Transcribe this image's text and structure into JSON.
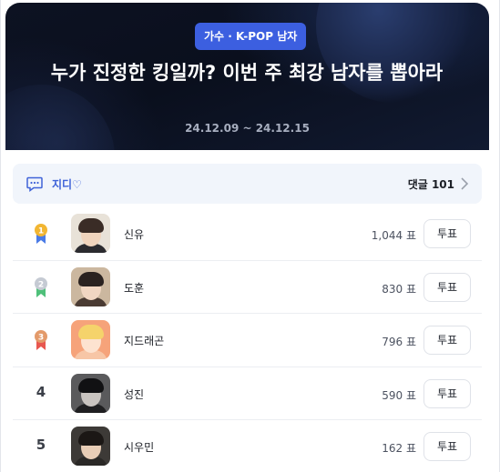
{
  "header": {
    "category_badge": "가수 · K-POP 남자",
    "title": "누가 진정한 킹일까? 이번 주 최강 남자를 뽑아라",
    "period": "24.12.09 ~ 24.12.15"
  },
  "comment_bar": {
    "user": "지디♡",
    "count_label": "댓글 101"
  },
  "ranking": [
    {
      "rank": "1",
      "name": "신유",
      "votes": "1,044 표",
      "button": "투표",
      "medal_color": "#f2b632",
      "ribbon_color": "#4a7be6"
    },
    {
      "rank": "2",
      "name": "도훈",
      "votes": "830 표",
      "button": "투표",
      "medal_color": "#c5cad3",
      "ribbon_color": "#4fc07a"
    },
    {
      "rank": "3",
      "name": "지드래곤",
      "votes": "796 표",
      "button": "투표",
      "medal_color": "#e39a6a",
      "ribbon_color": "#e8574f"
    },
    {
      "rank": "4",
      "name": "성진",
      "votes": "590 표",
      "button": "투표"
    },
    {
      "rank": "5",
      "name": "시우민",
      "votes": "162 표",
      "button": "투표"
    }
  ],
  "colors": {
    "accent": "#3c5fe0",
    "header_bg": "#0d1222"
  }
}
